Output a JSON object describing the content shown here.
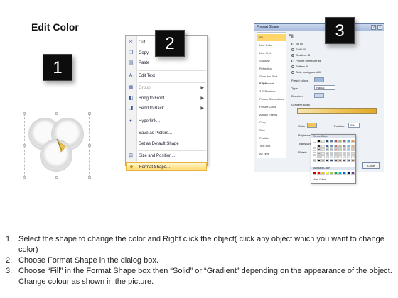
{
  "title": "Edit Color",
  "badges": [
    "1",
    "2",
    "3"
  ],
  "context_menu": {
    "items": [
      {
        "label": "Cut",
        "icon": "scissors-icon",
        "glyph": "✂"
      },
      {
        "label": "Copy",
        "icon": "copy-icon",
        "glyph": "❐"
      },
      {
        "label": "Paste",
        "icon": "paste-icon",
        "glyph": "▤"
      },
      {
        "label": "Edit Text",
        "icon": "edit-text-icon",
        "glyph": "A"
      },
      {
        "label": "Group",
        "icon": "group-icon",
        "glyph": "▦",
        "disabled": true,
        "submenu": true
      },
      {
        "label": "Bring to Front",
        "icon": "bring-front-icon",
        "glyph": "◧",
        "submenu": true
      },
      {
        "label": "Send to Back",
        "icon": "send-back-icon",
        "glyph": "◨",
        "submenu": true
      },
      {
        "label": "Hyperlink...",
        "icon": "hyperlink-icon",
        "glyph": "●"
      },
      {
        "label": "Save as Picture...",
        "icon": "",
        "glyph": ""
      },
      {
        "label": "Set as Default Shape",
        "icon": "",
        "glyph": ""
      },
      {
        "label": "Size and Position...",
        "icon": "size-position-icon",
        "glyph": "⊞"
      },
      {
        "label": "Format Shape...",
        "icon": "format-shape-icon",
        "glyph": "◆",
        "highlighted": true
      }
    ]
  },
  "dialog": {
    "title": "Format Shape",
    "help": "?",
    "close": "X",
    "nav": [
      "Fill",
      "Line Color",
      "Line Style",
      "Shadow",
      "Reflection",
      "Glow and Soft Edges",
      "3-D Format",
      "3-D Rotation",
      "Picture Corrections",
      "Picture Color",
      "Artistic Effects",
      "Crop",
      "Size",
      "Position",
      "Text Box",
      "Alt Text"
    ],
    "selected_nav": "Fill",
    "section": "Fill",
    "fill_options": [
      {
        "label": "No fill",
        "checked": false
      },
      {
        "label": "Solid fill",
        "checked": false
      },
      {
        "label": "Gradient fill",
        "checked": true
      },
      {
        "label": "Picture or texture fill",
        "checked": false
      },
      {
        "label": "Pattern fill",
        "checked": false
      },
      {
        "label": "Slide background fill",
        "checked": false
      }
    ],
    "preset_colors_label": "Preset colors:",
    "type_label": "Type:",
    "type_value": "Radial",
    "direction_label": "Direction:",
    "gradient_stops_label": "Gradient stops",
    "color_label": "Color",
    "position_label": "Position:",
    "position_value": "0%",
    "brightness_label": "Brightness:",
    "transparency_label": "Transparency:",
    "rotate_label": "Rotate",
    "close_button": "Close"
  },
  "palette": {
    "theme_header": "Theme Colors",
    "standard_header": "Standard Colors",
    "more": "More Colors...",
    "theme_colors": [
      "#ffffff",
      "#000000",
      "#eeece1",
      "#1f497d",
      "#4f81bd",
      "#c0504d",
      "#9bbb59",
      "#8064a2",
      "#4bacc6",
      "#f79646"
    ],
    "standard_colors": [
      "#c00000",
      "#ff0000",
      "#ffc000",
      "#ffff00",
      "#92d050",
      "#00b050",
      "#00b0f0",
      "#0070c0",
      "#002060",
      "#7030a0"
    ]
  },
  "instructions": [
    {
      "num": "1.",
      "text": "Select the shape to change the color and Right click the object( click any object which you want to change color)"
    },
    {
      "num": "2.",
      "text": "Choose Format Shape in the dialog box."
    },
    {
      "num": "3.",
      "text": "Choose “Fill” in the Format Shape box then “Solid” or “Gradient” depending on the appearance of the object. Change colour as shown in the picture."
    }
  ]
}
